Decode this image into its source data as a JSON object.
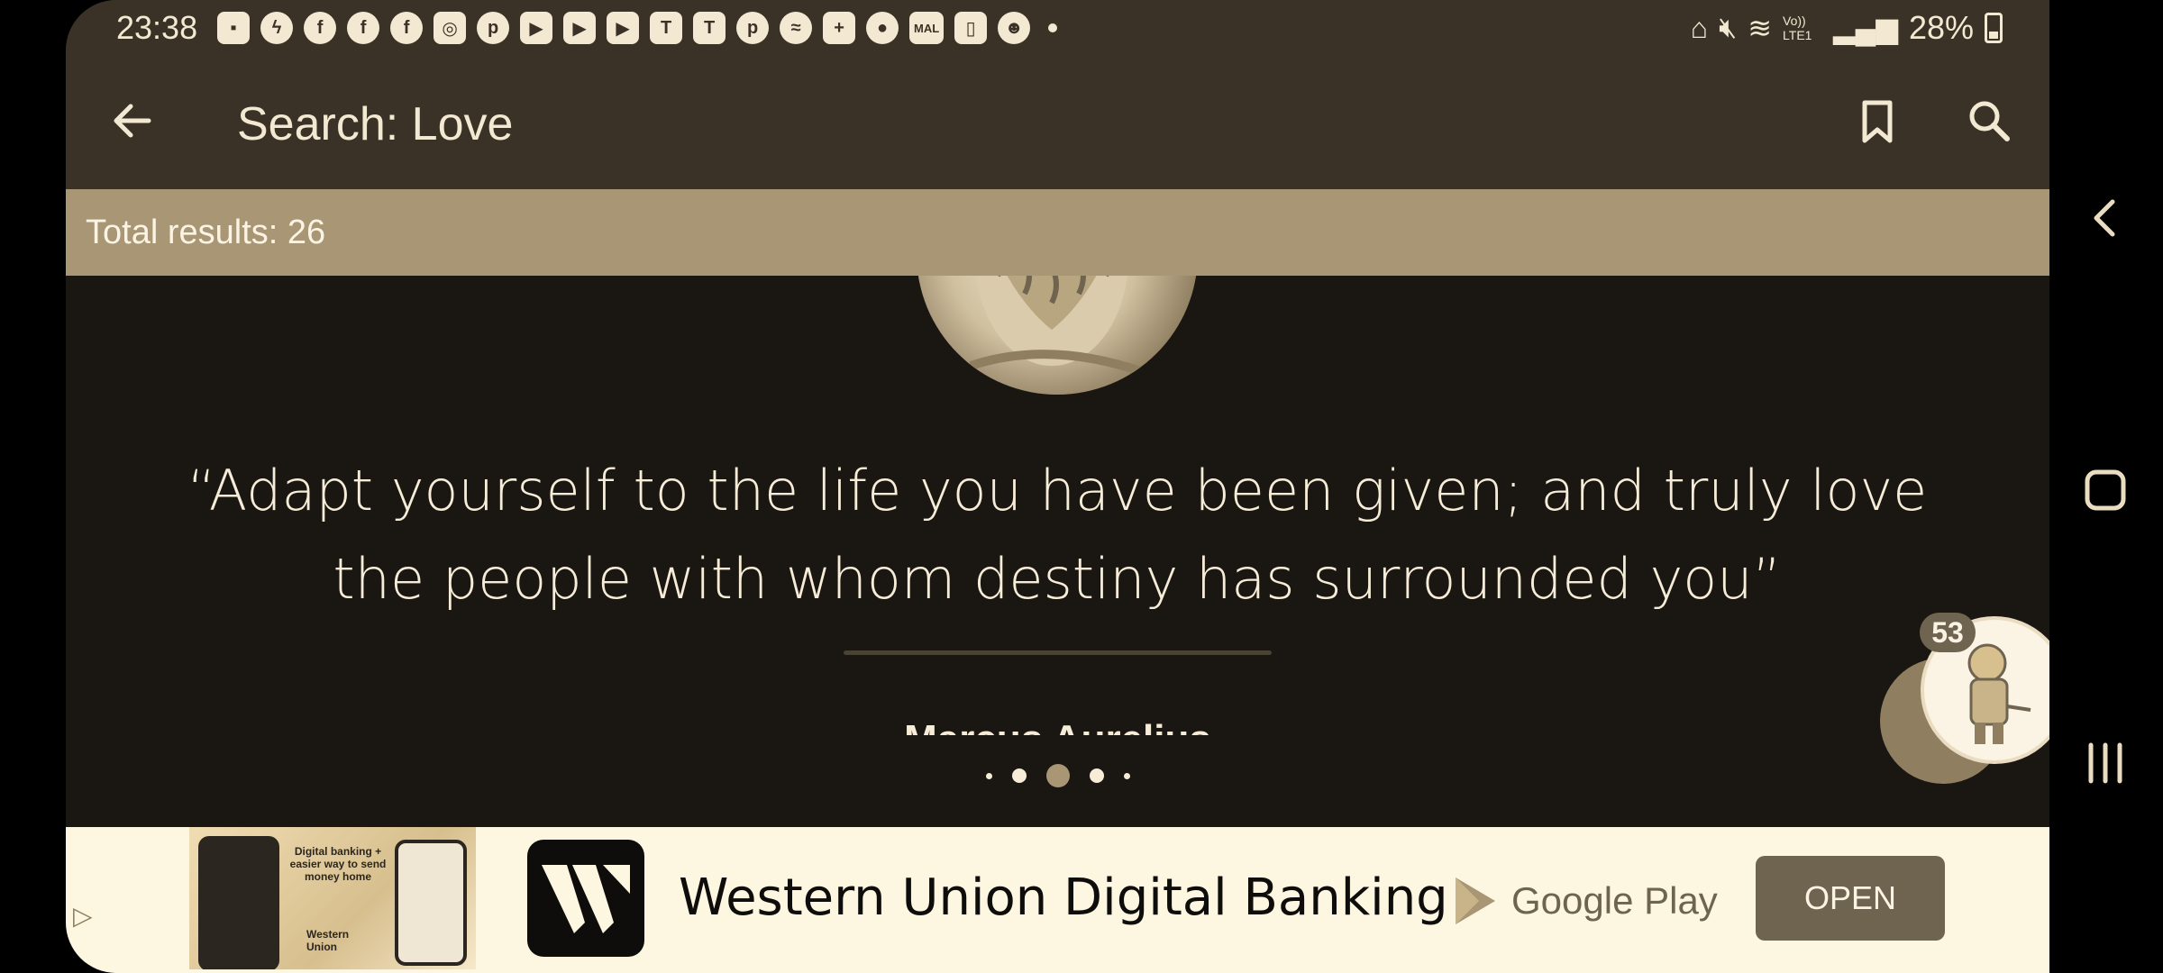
{
  "status_bar": {
    "time": "23:38",
    "notification_icons": [
      "message-icon",
      "messenger-icon",
      "facebook-icon",
      "facebook-icon",
      "facebook-icon",
      "instagram-icon",
      "pinterest-icon",
      "youtube-icon",
      "youtube-icon",
      "youtube-icon",
      "teams-icon",
      "teams-icon",
      "pinterest-icon",
      "feather-icon",
      "line-plus-icon",
      "contact-icon",
      "mal-icon",
      "phone-case-icon",
      "reddit-icon"
    ],
    "mal_label": "MAL",
    "battery": "28%",
    "network_label": "Vo)) LTE1"
  },
  "app_bar": {
    "title": "Search: Love"
  },
  "results": {
    "total_label": "Total results: 26"
  },
  "quote": {
    "text": "“Adapt yourself to the life you have been given; and truly love the people with whom destiny has surrounded you”",
    "author": "Marcus Aurelius",
    "page_index": 2,
    "page_count": 5
  },
  "chathead": {
    "badge": "53"
  },
  "ad": {
    "title": "Western Union Digital Banking",
    "image_text": "Digital banking + easier way to send money home",
    "image_brand": "Western Union",
    "store": "Google Play",
    "open_label": "OPEN"
  },
  "colors": {
    "app_bar": "#3a3226",
    "accent": "#a89674",
    "background": "#1a1713",
    "text": "#f6ecd7",
    "button": "#6f6450"
  }
}
